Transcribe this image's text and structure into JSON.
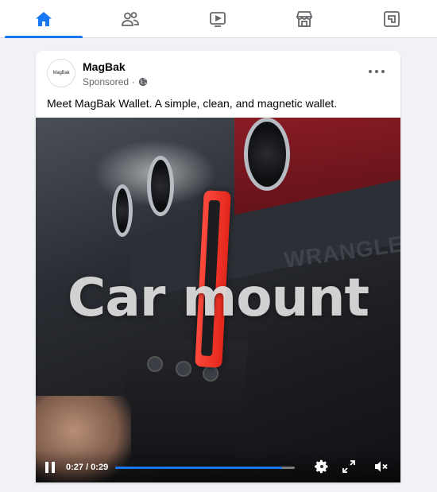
{
  "nav": {
    "items": [
      {
        "name": "home",
        "icon": "home-icon",
        "active": true
      },
      {
        "name": "friends",
        "icon": "friends-icon",
        "active": false
      },
      {
        "name": "watch",
        "icon": "watch-icon",
        "active": false
      },
      {
        "name": "marketplace",
        "icon": "marketplace-icon",
        "active": false
      },
      {
        "name": "gaming",
        "icon": "gaming-icon",
        "active": false
      }
    ],
    "active_color": "#1877f2",
    "inactive_color": "#65676b"
  },
  "post": {
    "avatar_text": "MagBak",
    "page_name": "MagBak",
    "sponsored_label": "Sponsored",
    "separator": "·",
    "audience_icon": "globe-icon",
    "more_icon": "more-options-icon",
    "text": "Meet MagBak Wallet. A simple, clean, and magnetic wallet."
  },
  "video": {
    "overlay_text": "Car mount",
    "background_text": "WRANGLER",
    "current_time": "0:27",
    "duration": "0:29",
    "time_display": "0:27 / 0:29",
    "progress": 0.93,
    "controls": [
      "pause-icon",
      "settings-icon",
      "fullscreen-icon",
      "muted-icon"
    ]
  }
}
